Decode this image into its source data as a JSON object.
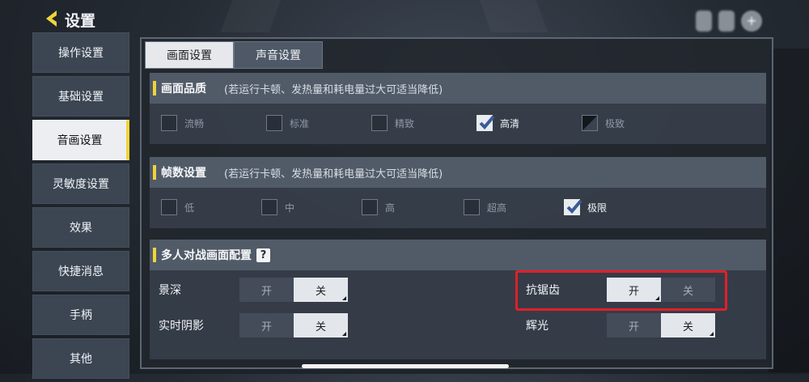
{
  "header": {
    "title": "设置",
    "top_buttons": [
      "",
      ""
    ]
  },
  "sidebar": {
    "items": [
      {
        "label": "操作设置"
      },
      {
        "label": "基础设置"
      },
      {
        "label": "音画设置"
      },
      {
        "label": "灵敏度设置"
      },
      {
        "label": "效果"
      },
      {
        "label": "快捷消息"
      },
      {
        "label": "手柄"
      },
      {
        "label": "其他"
      }
    ],
    "active_index": 2
  },
  "tabs": [
    {
      "label": "画面设置"
    },
    {
      "label": "声音设置"
    }
  ],
  "quality": {
    "title": "画面品质",
    "note": "(若运行卡顿、发热量和耗电量过大可适当降低)",
    "options": [
      {
        "label": "流畅",
        "state": "unchecked"
      },
      {
        "label": "标准",
        "state": "unchecked"
      },
      {
        "label": "精致",
        "state": "unchecked"
      },
      {
        "label": "高清",
        "state": "checked"
      },
      {
        "label": "极致",
        "state": "disabled"
      }
    ]
  },
  "fps": {
    "title": "帧数设置",
    "note": "(若运行卡顿、发热量和耗电量过大可适当降低)",
    "options": [
      {
        "label": "低",
        "state": "unchecked"
      },
      {
        "label": "中",
        "state": "unchecked"
      },
      {
        "label": "高",
        "state": "unchecked"
      },
      {
        "label": "超高",
        "state": "unchecked"
      },
      {
        "label": "极限",
        "state": "checked"
      }
    ]
  },
  "multiplayer": {
    "title": "多人对战画面配置",
    "help": "?",
    "on_label": "开",
    "off_label": "关",
    "toggles": [
      {
        "label": "景深",
        "value": "关"
      },
      {
        "label": "实时阴影",
        "value": "关"
      },
      {
        "label": "抗锯齿",
        "value": "开"
      },
      {
        "label": "辉光",
        "value": "关"
      }
    ]
  },
  "colors": {
    "accent": "#f0d43a",
    "highlight": "#e0202a"
  }
}
